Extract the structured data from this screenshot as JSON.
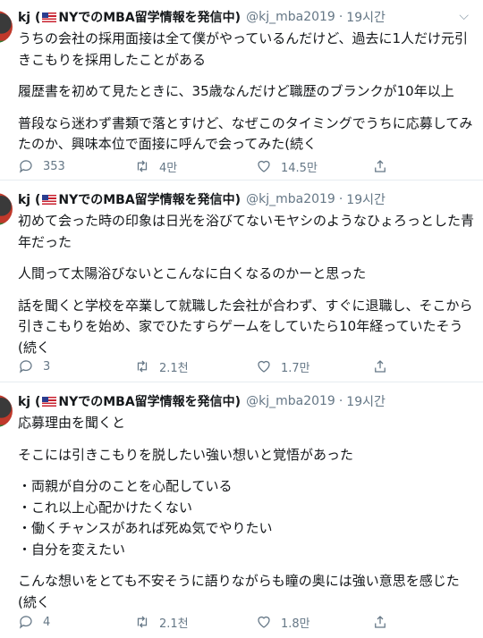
{
  "tweets": [
    {
      "name_prefix": "kj (",
      "name_suffix": "NYでのMBA留学情報を発信中)",
      "handle": "@kj_mba2019",
      "time": "19시간",
      "paragraphs": [
        "うちの会社の採用面接は全て僕がやっているんだけど、過去に1人だけ元引きこもりを採用したことがある",
        "履歴書を初めて見たときに、35歳なんだけど職歴のブランクが10年以上",
        "普段なら迷わず書類で落とすけど、なぜこのタイミングでうちに応募してみたのか、興味本位で面接に呼んで会ってみた(続く"
      ],
      "replies": "353",
      "retweets": "4만",
      "likes": "14.5만"
    },
    {
      "name_prefix": "kj (",
      "name_suffix": "NYでのMBA留学情報を発信中)",
      "handle": "@kj_mba2019",
      "time": "19시간",
      "paragraphs": [
        "初めて会った時の印象は日光を浴びてないモヤシのようなひょろっとした青年だった",
        "人間って太陽浴びないとこんなに白くなるのかーと思った",
        "話を聞くと学校を卒業して就職した会社が合わず、すぐに退職し、そこから引きこもりを始め、家でひたすらゲームをしていたら10年経っていたそう(続く"
      ],
      "replies": "3",
      "retweets": "2.1천",
      "likes": "1.7만"
    },
    {
      "name_prefix": "kj (",
      "name_suffix": "NYでのMBA留学情報を発信中)",
      "handle": "@kj_mba2019",
      "time": "19시간",
      "paragraphs": [
        "応募理由を聞くと",
        "そこには引きこもりを脱したい強い想いと覚悟があった",
        "・両親が自分のことを心配している\n・これ以上心配かけたくない\n・働くチャンスがあれば死ぬ気でやりたい\n・自分を変えたい",
        "こんな想いをとても不安そうに語りながらも瞳の奥には強い意思を感じた(続く"
      ],
      "replies": "4",
      "retweets": "2.1천",
      "likes": "1.8만"
    }
  ]
}
